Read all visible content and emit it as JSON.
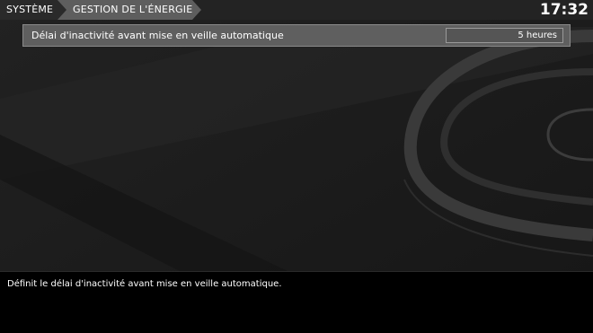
{
  "breadcrumb": {
    "home": "SYSTÈME",
    "current": "GESTION DE L'ÉNERGIE"
  },
  "clock": "17:32",
  "setting": {
    "label": "Délai d'inactivité avant mise en veille automatique",
    "value": "5 heures"
  },
  "description": "Définit le délai d'inactivité avant mise en veille automatique.",
  "colors": {
    "background": "#1c1c1c",
    "row_highlight": "#5f5f5f",
    "breadcrumb_active": "#5e5e5e",
    "panel": "#000000"
  }
}
